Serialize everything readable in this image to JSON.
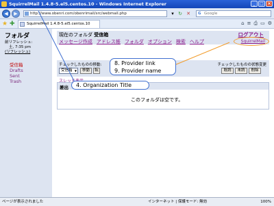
{
  "window": {
    "title": "SquirrelMail 1.4.8-5.el5.centos.10 - Windows Internet Explorer"
  },
  "addressbar": {
    "url": "http://www.obenri.com/obenrimail/src/webmail.php",
    "search_placeholder": "Google"
  },
  "tab": {
    "title": "SquirrelMail 1.4.8-5.el5.centos.10"
  },
  "sidebar": {
    "title": "フォルダ",
    "refresh_label": "前リフレッシュ:",
    "refresh_time": "土, 7:35 pm",
    "refresh_link": "(リフレッシュ)",
    "folders": [
      {
        "label": "受信箱"
      },
      {
        "label": "Drafts"
      },
      {
        "label": "Sent"
      },
      {
        "label": "Trash"
      }
    ]
  },
  "main": {
    "current_folder_label": "現在のフォルダ",
    "current_folder_name": "受信箱",
    "logout": "ログアウト",
    "menu": [
      "メッセージ作成",
      "アドレス帳",
      "フォルダ",
      "オプション",
      "検索",
      "ヘルプ"
    ],
    "provider_link": "SquirrelMail",
    "move_label": "チェックしたものの移動:",
    "move_select": "受信箱",
    "move_button": "移動",
    "forward_button": "転",
    "state_label": "チェックしたものの状態変更",
    "read_button": "既読",
    "unread_button": "未読",
    "delete_button": "削除",
    "thread_link": "スレッド表示",
    "list_header": "差出",
    "empty_message": "このフォルダは空です。"
  },
  "callouts": {
    "provider_link": "8. Provider link",
    "provider_name": "9. Provider name",
    "organization_title": "4. Organization Title"
  },
  "statusbar": {
    "left": "ページが表示されました",
    "zone": "インターネット | 保護モード: 無効",
    "zoom": "100%"
  },
  "colors": {
    "link": "#8b1c8b",
    "current_folder": "#c10000",
    "panel_bg": "#dde4f1",
    "callout_border": "#3f6fd0",
    "provider_ellipse": "#f29c2b"
  }
}
